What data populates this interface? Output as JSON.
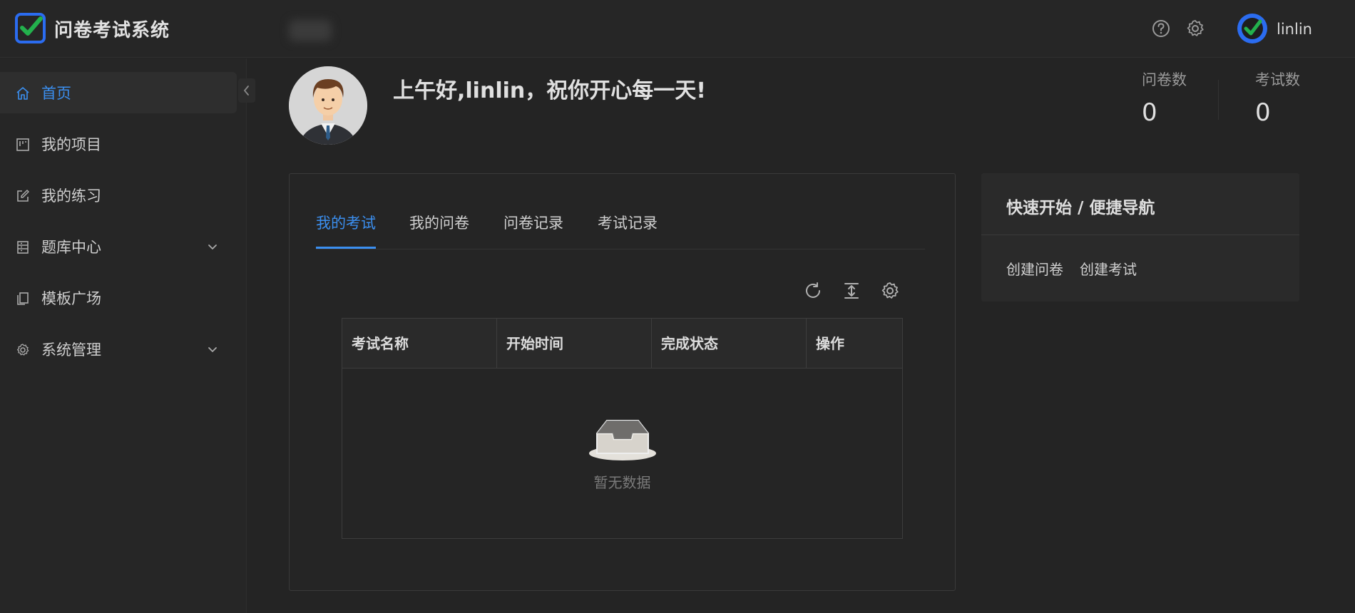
{
  "app": {
    "title": "问卷考试系统",
    "brand_color": "#2b6cf0",
    "check_color": "#23b14d",
    "accent": "#3b8ff0"
  },
  "header": {
    "user_name": "linlin",
    "icons": [
      "help-icon",
      "gear-icon",
      "user-avatar-icon"
    ]
  },
  "sidebar": {
    "items": [
      {
        "label": "首页",
        "icon": "home-icon",
        "active": true
      },
      {
        "label": "我的项目",
        "icon": "project-icon"
      },
      {
        "label": "我的练习",
        "icon": "edit-icon"
      },
      {
        "label": "题库中心",
        "icon": "question-bank-icon",
        "expandable": true
      },
      {
        "label": "模板广场",
        "icon": "template-icon"
      },
      {
        "label": "系统管理",
        "icon": "settings-icon",
        "expandable": true
      }
    ]
  },
  "greeting": {
    "text": "上午好,linlin，祝你开心每一天!"
  },
  "stats": [
    {
      "label": "问卷数",
      "value": "0"
    },
    {
      "label": "考试数",
      "value": "0"
    }
  ],
  "main": {
    "tabs": [
      {
        "label": "我的考试",
        "active": true
      },
      {
        "label": "我的问卷"
      },
      {
        "label": "问卷记录"
      },
      {
        "label": "考试记录"
      }
    ],
    "toolbar_icons": [
      "refresh-icon",
      "density-icon",
      "column-settings-icon"
    ],
    "table": {
      "columns": [
        "考试名称",
        "开始时间",
        "完成状态",
        "操作"
      ],
      "rows": [],
      "empty_text": "暂无数据"
    }
  },
  "quick_nav": {
    "title": "快速开始 / 便捷导航",
    "links": [
      "创建问卷",
      "创建考试"
    ]
  }
}
